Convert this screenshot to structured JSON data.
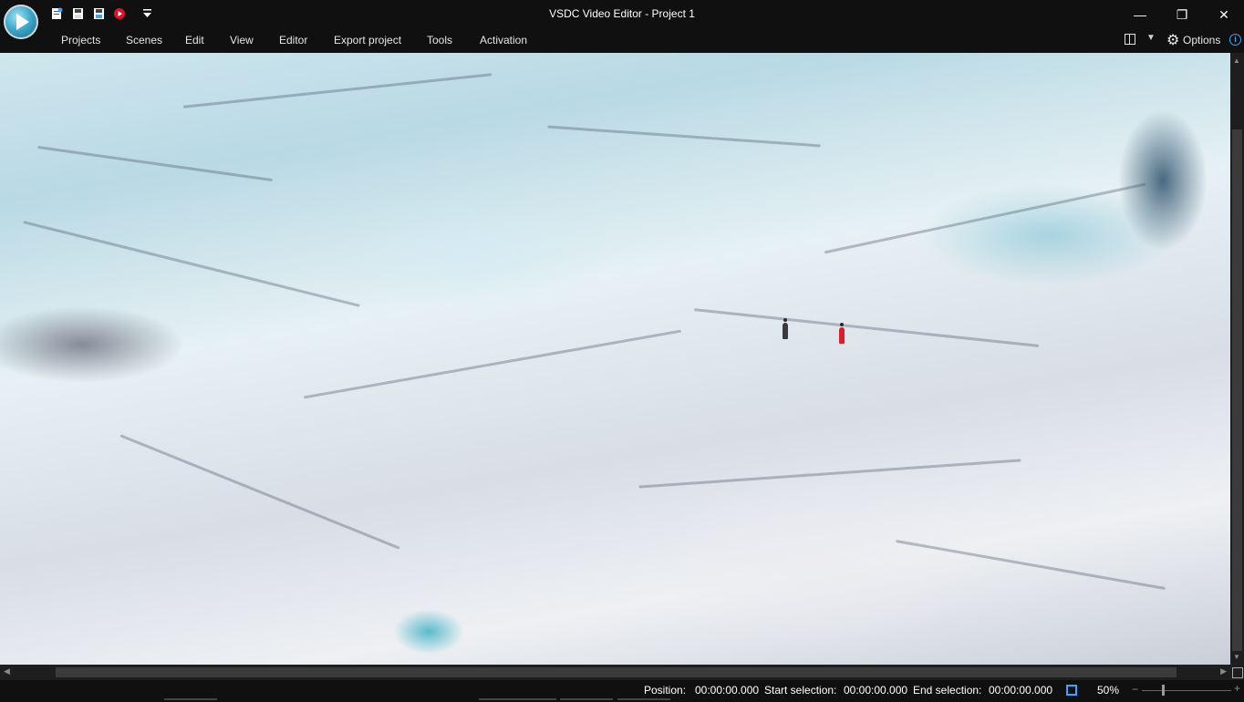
{
  "window": {
    "title": "VSDC Video Editor - Project 1",
    "minimize": "—",
    "restore": "❐",
    "close": "✕"
  },
  "quick_access": [
    "new-project-icon",
    "save-icon",
    "save-as-icon",
    "record-icon",
    "customize-dropdown-icon"
  ],
  "menu": {
    "items": [
      {
        "label": "Projects"
      },
      {
        "label": "Scenes"
      },
      {
        "label": "Edit"
      },
      {
        "label": "View"
      },
      {
        "label": "Editor"
      },
      {
        "label": "Export project"
      },
      {
        "label": "Tools"
      },
      {
        "label": "Activation"
      }
    ],
    "options_label": "Options",
    "info": "i"
  },
  "colors": {
    "accent": "#3da3ff",
    "record": "#e0102a",
    "background": "#101010"
  },
  "statusbar": {
    "position_label": "Position:",
    "position_value": "00:00:00.000",
    "start_label": "Start selection:",
    "start_value": "00:00:00.000",
    "end_label": "End selection:",
    "end_value": "00:00:00.000",
    "zoom": "50%",
    "zoom_minus": "−",
    "zoom_plus": "+"
  }
}
